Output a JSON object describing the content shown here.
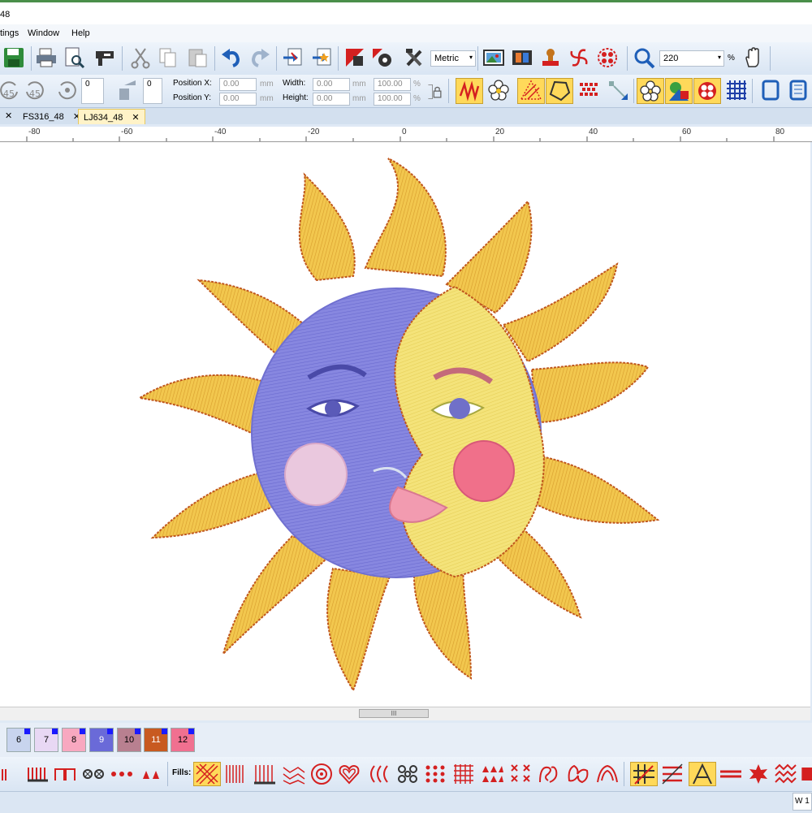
{
  "window": {
    "title_fragment": "48"
  },
  "menu": {
    "items": [
      "tings",
      "Window",
      "Help"
    ]
  },
  "toolbar": {
    "units_select": "Metric",
    "zoom_value": "220",
    "zoom_unit": "%"
  },
  "transform": {
    "rotate_value": "0",
    "slant_value": "0",
    "position_x_label": "Position X:",
    "position_y_label": "Position Y:",
    "position_x": "0.00",
    "position_y": "0.00",
    "width_label": "Width:",
    "height_label": "Height:",
    "width": "0.00",
    "height": "0.00",
    "width_pct": "100.00",
    "height_pct": "100.00",
    "unit_mm": "mm",
    "unit_pct": "%"
  },
  "tabs": [
    {
      "label": "FS316_48",
      "active": false
    },
    {
      "label": "LJ634_48",
      "active": true
    }
  ],
  "ruler": {
    "labels": [
      "-80",
      "-60",
      "-40",
      "-20",
      "0",
      "20",
      "40",
      "60",
      "80"
    ]
  },
  "scrollbar": {
    "thumb_glyph": "III"
  },
  "palette": {
    "swatches": [
      {
        "n": "6",
        "color": "#c8d4ee"
      },
      {
        "n": "7",
        "color": "#e8d8f4"
      },
      {
        "n": "8",
        "color": "#f8a8c0"
      },
      {
        "n": "9",
        "color": "#6a6ad8"
      },
      {
        "n": "10",
        "color": "#b88090"
      },
      {
        "n": "11",
        "color": "#c85a20"
      },
      {
        "n": "12",
        "color": "#f07090"
      }
    ]
  },
  "stitches": {
    "fills_label": "Fills:"
  },
  "status": {
    "text": "W 1"
  },
  "colors": {
    "accent": "#d42020",
    "highlight": "#ffd95a"
  }
}
